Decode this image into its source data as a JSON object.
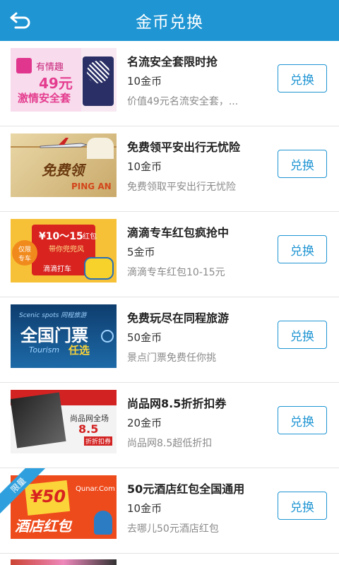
{
  "header": {
    "title": "金币兑换"
  },
  "items": [
    {
      "title": "名流安全套限时抢",
      "cost": "10金币",
      "desc": "价值49元名流安全套，...",
      "button": "兑换",
      "thumb": {
        "brand": "有情趣",
        "price": "49元",
        "slogan": "激情安全套"
      }
    },
    {
      "title": "免费领平安出行无忧险",
      "cost": "10金币",
      "desc": "免费领取平安出行无忧险",
      "button": "兑换",
      "thumb": {
        "big": "免费领",
        "brand": "PING AN"
      }
    },
    {
      "title": "滴滴专车红包疯抢中",
      "cost": "5金币",
      "desc": "滴滴专车红包10-15元",
      "button": "兑换",
      "thumb": {
        "amount": "¥10～15",
        "unit": "红包",
        "sub": "带你兜兜风",
        "tag1": "仅限",
        "tag2": "专车",
        "brand": "滴滴打车"
      }
    },
    {
      "title": "免费玩尽在同程旅游",
      "cost": "50金币",
      "desc": "景点门票免费任你挑",
      "button": "兑换",
      "thumb": {
        "top": "Scenic spots 同程旅游",
        "main": "全国门票",
        "sub": "Tourism",
        "pick": "任选"
      }
    },
    {
      "title": "尚品网8.5折折扣券",
      "cost": "20金币",
      "desc": "尚品网8.5超低折扣",
      "button": "兑换",
      "thumb": {
        "line1": "尚品网全场",
        "line2": "8.5",
        "line3": "折折扣券"
      }
    },
    {
      "title": "50元酒店红包全国通用",
      "cost": "10金币",
      "desc": "去哪儿50元酒店红包",
      "button": "兑换",
      "badge": "限量",
      "thumb": {
        "amount": "¥50",
        "brand": "Qunar.Com",
        "main": "酒店红包"
      }
    }
  ]
}
